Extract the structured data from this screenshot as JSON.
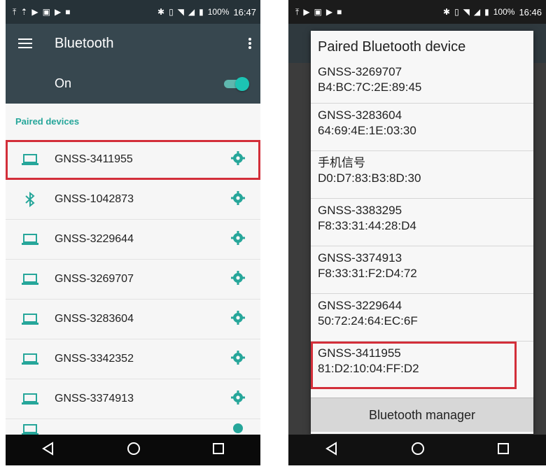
{
  "left": {
    "status": {
      "battery": "100%",
      "time": "16:47"
    },
    "toolbar": {
      "title": "Bluetooth"
    },
    "toggle": {
      "label": "On",
      "state": "on"
    },
    "section_header": "Paired devices",
    "devices": [
      {
        "name": "GNSS-3411955",
        "icon": "laptop-icon",
        "highlighted": true
      },
      {
        "name": "GNSS-1042873",
        "icon": "bluetooth-icon",
        "highlighted": false
      },
      {
        "name": "GNSS-3229644",
        "icon": "laptop-icon",
        "highlighted": false
      },
      {
        "name": "GNSS-3269707",
        "icon": "laptop-icon",
        "highlighted": false
      },
      {
        "name": "GNSS-3283604",
        "icon": "laptop-icon",
        "highlighted": false
      },
      {
        "name": "GNSS-3342352",
        "icon": "laptop-icon",
        "highlighted": false
      },
      {
        "name": "GNSS-3374913",
        "icon": "laptop-icon",
        "highlighted": false
      }
    ]
  },
  "right": {
    "status": {
      "battery": "100%",
      "time": "16:46"
    },
    "dialog": {
      "title": "Paired Bluetooth device",
      "items": [
        {
          "name": "GNSS-3269707",
          "mac": "B4:BC:7C:2E:89:45"
        },
        {
          "name": "GNSS-3283604",
          "mac": "64:69:4E:1E:03:30"
        },
        {
          "name": "手机信号",
          "mac": "D0:D7:83:B3:8D:30"
        },
        {
          "name": "GNSS-3383295",
          "mac": "F8:33:31:44:28:D4"
        },
        {
          "name": "GNSS-3374913",
          "mac": "F8:33:31:F2:D4:72"
        },
        {
          "name": "GNSS-3229644",
          "mac": "50:72:24:64:EC:6F"
        },
        {
          "name": "GNSS-3411955",
          "mac": "81:D2:10:04:FF:D2",
          "highlighted": true
        }
      ],
      "button_label": "Bluetooth manager"
    }
  },
  "colors": {
    "accent": "#26a69a",
    "toolbar": "#37474f",
    "highlight": "#d32f3a"
  }
}
